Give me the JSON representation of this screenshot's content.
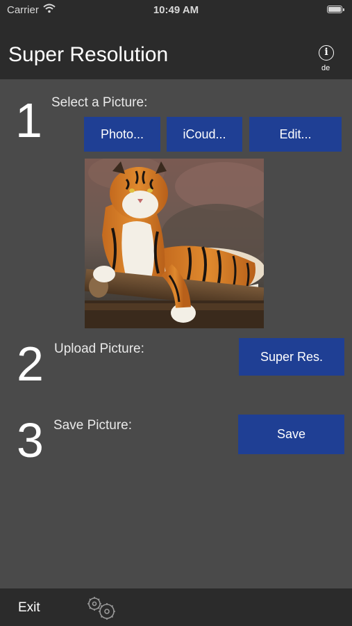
{
  "status_bar": {
    "carrier": "Carrier",
    "time": "10:49 AM",
    "wifi_icon": "wifi-icon",
    "battery_icon": "battery-icon"
  },
  "nav": {
    "title": "Super Resolution",
    "info_icon": "info-icon",
    "info_glyph": "i",
    "language": "de"
  },
  "steps": {
    "step1": {
      "number": "1",
      "label": "Select a Picture:",
      "buttons": {
        "photo": "Photo...",
        "icloud": "iCoud...",
        "edit": "Edit..."
      }
    },
    "step2": {
      "number": "2",
      "label": "Upload Picture:",
      "button": "Super Res."
    },
    "step3": {
      "number": "3",
      "label": "Save Picture:",
      "button": "Save"
    }
  },
  "picture": {
    "subject": "tiger-photo"
  },
  "bottom_bar": {
    "exit_label": "Exit",
    "settings_icon": "gears-icon"
  },
  "colors": {
    "background": "#4a4a4a",
    "bar": "#2b2b2b",
    "button": "#1f3f94"
  }
}
